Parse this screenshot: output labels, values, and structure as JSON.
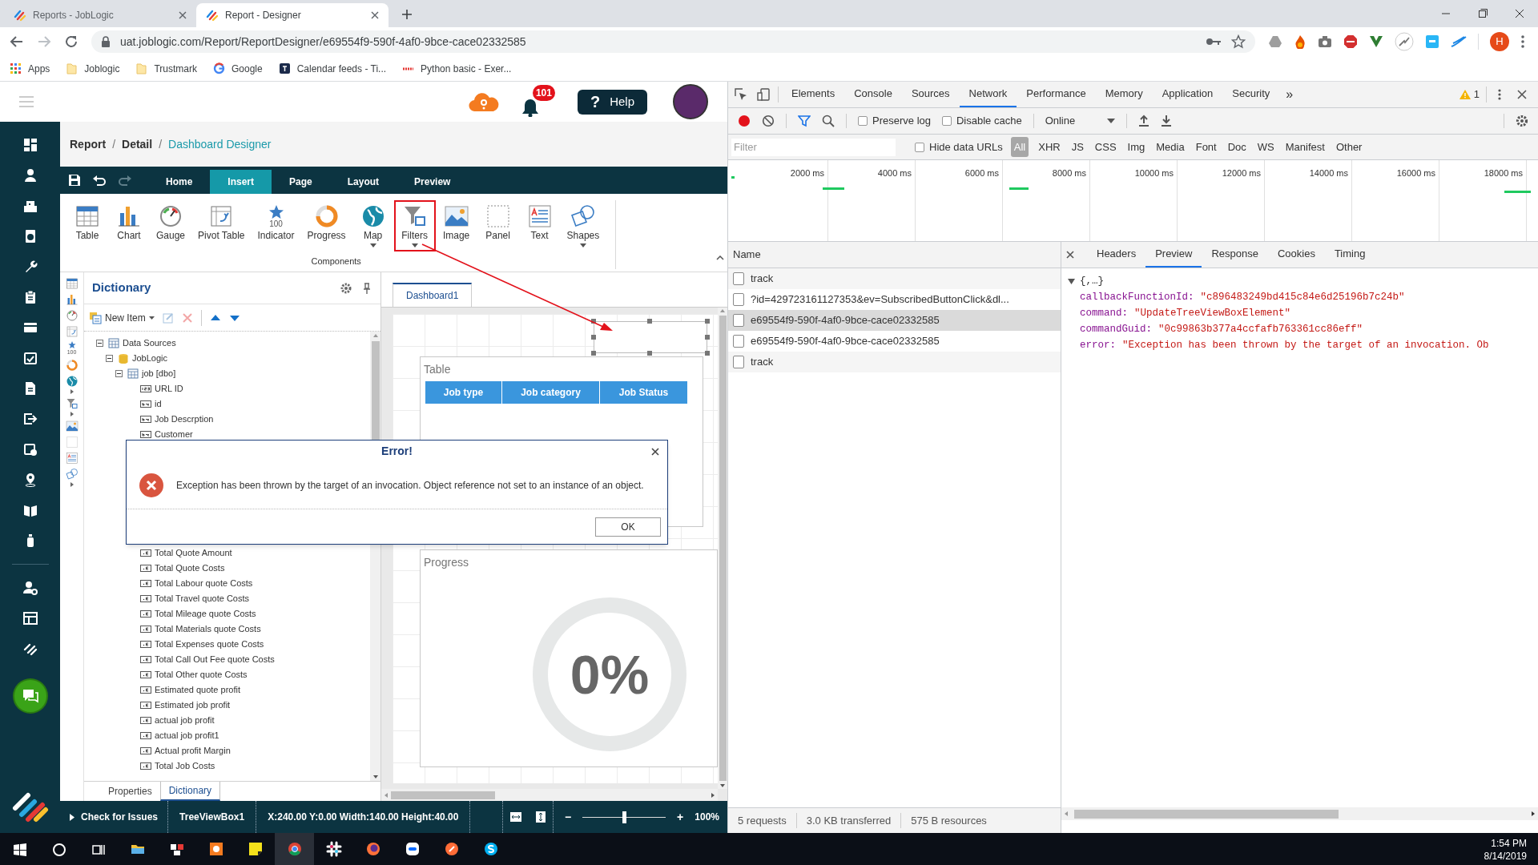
{
  "browser": {
    "tabs": [
      {
        "title": "Reports - JobLogic",
        "selected": false
      },
      {
        "title": "Report - Designer",
        "selected": true
      }
    ],
    "url": "uat.joblogic.com/Report/ReportDesigner/e69554f9-590f-4af0-9bce-cace02332585",
    "bookmarks": [
      {
        "label": "Apps",
        "kind": "apps"
      },
      {
        "label": "Joblogic",
        "kind": "folder"
      },
      {
        "label": "Trustmark",
        "kind": "folder"
      },
      {
        "label": "Google",
        "kind": "google"
      },
      {
        "label": "Calendar feeds - Ti...",
        "kind": "calendar"
      },
      {
        "label": "Python basic - Exer...",
        "kind": "site"
      }
    ],
    "profile": "H"
  },
  "app_header": {
    "notifications": "101",
    "help_icon": "?",
    "help": "Help"
  },
  "breadcrumb": {
    "items": [
      {
        "label": "Report",
        "current": false
      },
      {
        "label": "Detail",
        "current": false
      },
      {
        "label": "Dashboard Designer",
        "current": true
      }
    ],
    "separators": [
      "/",
      "/"
    ]
  },
  "ribbon": {
    "tabs": [
      {
        "label": "Home",
        "selected": false
      },
      {
        "label": "Insert",
        "selected": true
      },
      {
        "label": "Page",
        "selected": false
      },
      {
        "label": "Layout",
        "selected": false
      },
      {
        "label": "Preview",
        "selected": false
      }
    ],
    "components": [
      {
        "label": "Table",
        "dropdown": false,
        "highlighted": false
      },
      {
        "label": "Chart",
        "dropdown": false,
        "highlighted": false
      },
      {
        "label": "Gauge",
        "dropdown": false,
        "highlighted": false
      },
      {
        "label": "Pivot Table",
        "dropdown": false,
        "highlighted": false
      },
      {
        "label": "Indicator",
        "dropdown": false,
        "highlighted": false,
        "icon_text": "100"
      },
      {
        "label": "Progress",
        "dropdown": false,
        "highlighted": false
      },
      {
        "label": "Map",
        "dropdown": true,
        "highlighted": false
      },
      {
        "label": "Filters",
        "dropdown": true,
        "highlighted": true
      },
      {
        "label": "Image",
        "dropdown": false,
        "highlighted": false
      },
      {
        "label": "Panel",
        "dropdown": false,
        "highlighted": false
      },
      {
        "label": "Text",
        "dropdown": false,
        "highlighted": false
      },
      {
        "label": "Shapes",
        "dropdown": true,
        "highlighted": false
      }
    ],
    "group": "Components"
  },
  "dictionary": {
    "title": "Dictionary",
    "strip_indicator_text": "100",
    "new_item": "New Item",
    "tree": [
      {
        "label": "Data Sources",
        "kind": "datasource",
        "expanded": true,
        "children": [
          {
            "label": "JobLogic",
            "kind": "database",
            "expanded": true,
            "children": [
              {
                "label": "job [dbo]",
                "kind": "table",
                "expanded": true,
                "children": [
                  {
                    "label": "URL ID",
                    "kind": "number"
                  },
                  {
                    "label": "id",
                    "kind": "text"
                  },
                  {
                    "label": "Job Descrption",
                    "kind": "text"
                  },
                  {
                    "label": "Customer",
                    "kind": "text"
                  },
                  {
                    "label": "Total Quote Amount",
                    "kind": "calc"
                  },
                  {
                    "label": "Total Quote Costs",
                    "kind": "calc"
                  },
                  {
                    "label": "Total Labour quote Costs",
                    "kind": "calc"
                  },
                  {
                    "label": "Total Travel quote Costs",
                    "kind": "calc"
                  },
                  {
                    "label": "Total Mileage quote Costs",
                    "kind": "calc"
                  },
                  {
                    "label": "Total Materials quote Costs",
                    "kind": "calc"
                  },
                  {
                    "label": "Total Expenses quote Costs",
                    "kind": "calc"
                  },
                  {
                    "label": "Total Call Out Fee quote Costs",
                    "kind": "calc"
                  },
                  {
                    "label": "Total Other quote Costs",
                    "kind": "calc"
                  },
                  {
                    "label": "Estimated quote profit",
                    "kind": "calc"
                  },
                  {
                    "label": "Estimated job profit",
                    "kind": "calc"
                  },
                  {
                    "label": "actual job profit",
                    "kind": "calc"
                  },
                  {
                    "label": "actual job profit1",
                    "kind": "calc"
                  },
                  {
                    "label": "Actual profit Margin",
                    "kind": "calc"
                  },
                  {
                    "label": "Total Job Costs",
                    "kind": "calc"
                  }
                ]
              }
            ]
          }
        ]
      }
    ],
    "tabs": [
      {
        "label": "Properties",
        "selected": false
      },
      {
        "label": "Dictionary",
        "selected": true
      }
    ]
  },
  "designer": {
    "tab": "Dashboard1",
    "table": {
      "title": "Table",
      "columns": [
        "Job type",
        "Job category",
        "Job Status"
      ]
    },
    "progress": {
      "title": "Progress",
      "value": "0%"
    }
  },
  "status_bar": {
    "check": "Check for Issues",
    "selection": "TreeViewBox1",
    "geometry": "X:240.00 Y:0.00 Width:140.00 Height:40.00",
    "zoom_out": "−",
    "zoom_in": "+",
    "zoom": "100%",
    "zoom_slider": {
      "level": 0.5
    }
  },
  "dialog": {
    "title": "Error!",
    "message": "Exception has been thrown by the target of an invocation. Object reference not set to an instance of an object.",
    "button": "OK"
  },
  "devtools": {
    "tabs": [
      {
        "label": "Elements",
        "selected": false
      },
      {
        "label": "Console",
        "selected": false
      },
      {
        "label": "Sources",
        "selected": false
      },
      {
        "label": "Network",
        "selected": true
      },
      {
        "label": "Performance",
        "selected": false
      },
      {
        "label": "Memory",
        "selected": false
      },
      {
        "label": "Application",
        "selected": false
      },
      {
        "label": "Security",
        "selected": false
      }
    ],
    "more": "»",
    "warnings": "1",
    "preserve_log": {
      "label": "Preserve log",
      "checked": false
    },
    "disable_cache": {
      "label": "Disable cache",
      "checked": false
    },
    "throttling": "Online",
    "filter_placeholder": "Filter",
    "hide_data_urls": {
      "label": "Hide data URLs",
      "checked": false
    },
    "type_filters": [
      {
        "label": "All",
        "selected": true
      },
      {
        "label": "XHR",
        "selected": false
      },
      {
        "label": "JS",
        "selected": false
      },
      {
        "label": "CSS",
        "selected": false
      },
      {
        "label": "Img",
        "selected": false
      },
      {
        "label": "Media",
        "selected": false
      },
      {
        "label": "Font",
        "selected": false
      },
      {
        "label": "Doc",
        "selected": false
      },
      {
        "label": "WS",
        "selected": false
      },
      {
        "label": "Manifest",
        "selected": false
      },
      {
        "label": "Other",
        "selected": false
      }
    ],
    "ticks": [
      "2000 ms",
      "4000 ms",
      "6000 ms",
      "8000 ms",
      "10000 ms",
      "12000 ms",
      "14000 ms",
      "16000 ms",
      "18000 ms"
    ],
    "name_header": "Name",
    "requests": [
      {
        "name": "track",
        "selected": false
      },
      {
        "name": "?id=429723161127353&ev=SubscribedButtonClick&dl...",
        "selected": false
      },
      {
        "name": "e69554f9-590f-4af0-9bce-cace02332585",
        "selected": true
      },
      {
        "name": "e69554f9-590f-4af0-9bce-cace02332585",
        "selected": false
      },
      {
        "name": "track",
        "selected": false
      }
    ],
    "detail_tabs": [
      {
        "label": "Headers",
        "selected": false
      },
      {
        "label": "Preview",
        "selected": true
      },
      {
        "label": "Response",
        "selected": false
      },
      {
        "label": "Cookies",
        "selected": false
      },
      {
        "label": "Timing",
        "selected": false
      }
    ],
    "preview": {
      "root": "{,…}",
      "expanded": true,
      "fields": [
        {
          "key": "callbackFunctionId:",
          "value": "\"c896483249bd415c84e6d25196b7c24b\""
        },
        {
          "key": "command:",
          "value": "\"UpdateTreeViewBoxElement\""
        },
        {
          "key": "commandGuid:",
          "value": "\"0c99863b377a4ccfafb763361cc86eff\""
        },
        {
          "key": "error:",
          "value": "\"Exception has been thrown by the target of an invocation. Ob"
        }
      ]
    },
    "summary": [
      "5 requests",
      "3.0 KB transferred",
      "575 B resources"
    ]
  },
  "taskbar": {
    "time": "1:54 PM",
    "date": "8/14/2019"
  }
}
